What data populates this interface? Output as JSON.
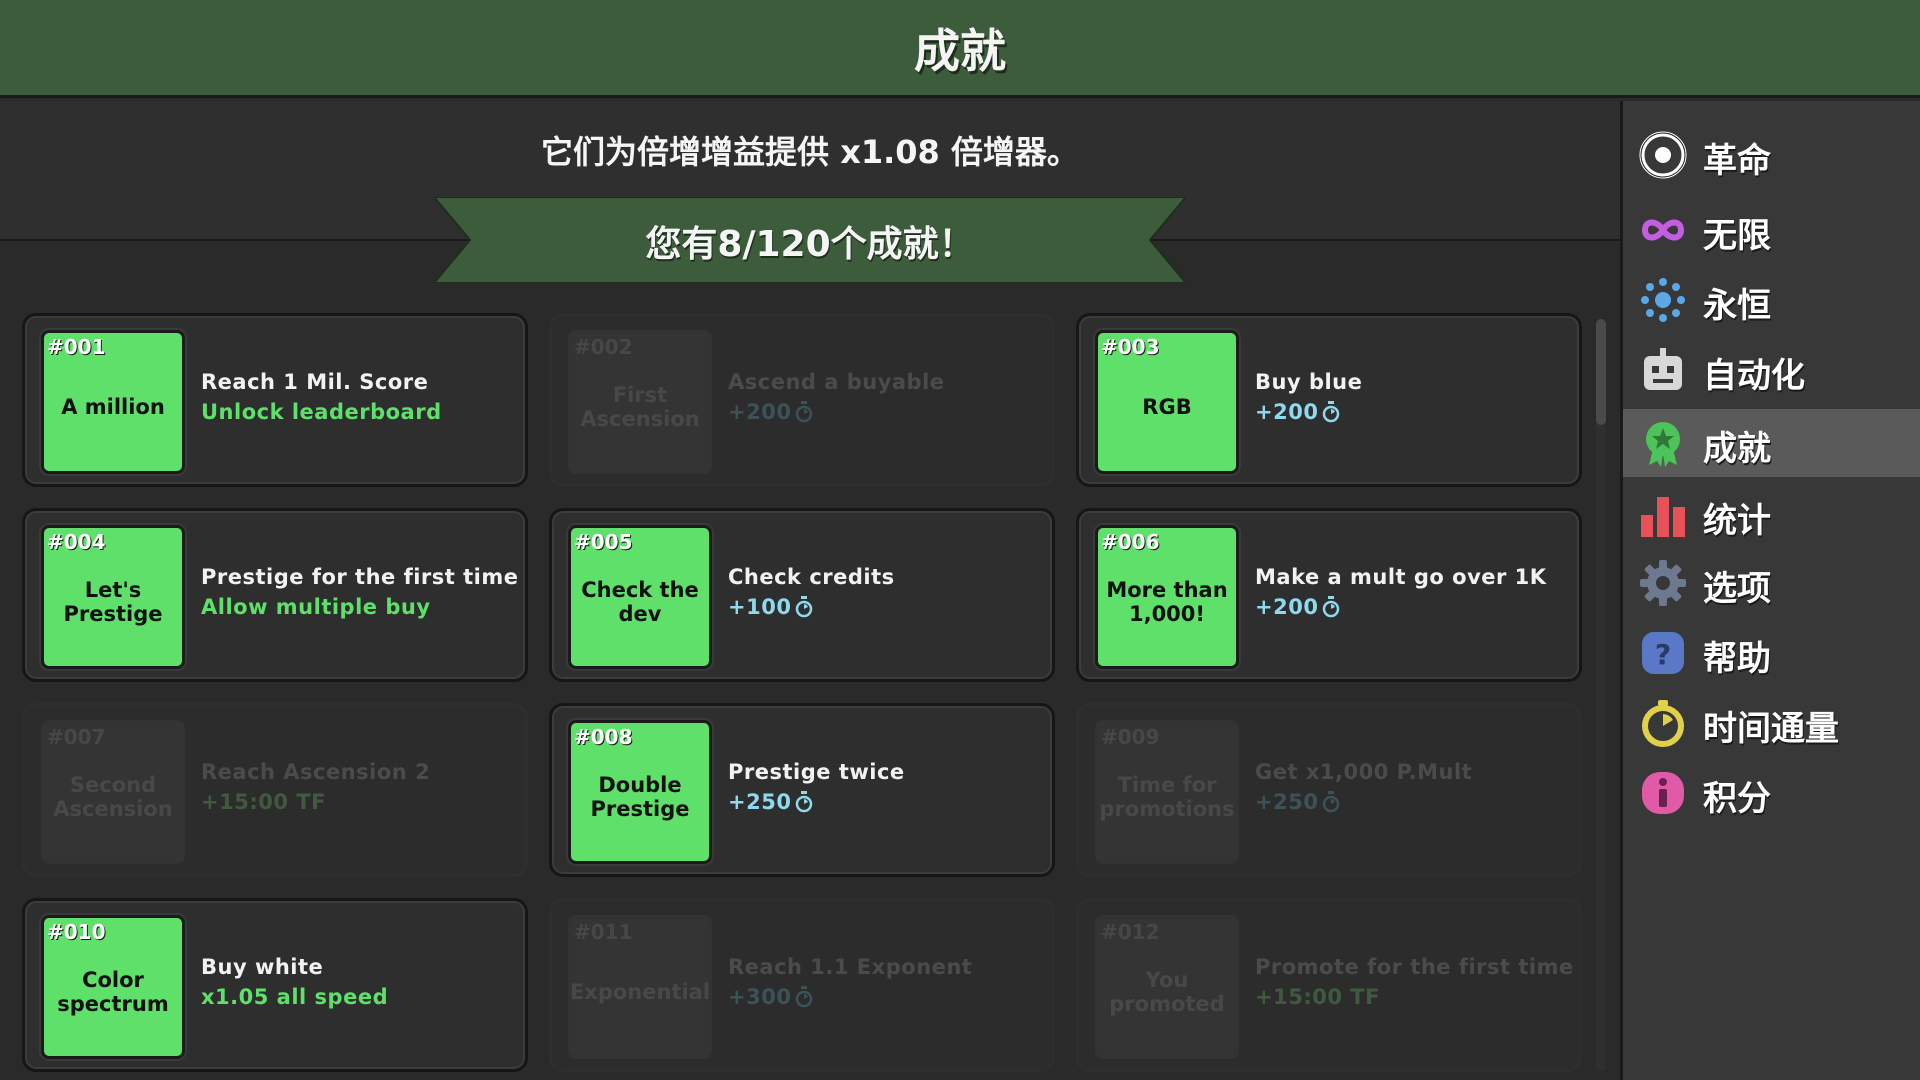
{
  "header": {
    "title": "成就"
  },
  "subtitle": "它们为倍增增益提供 x1.08 倍增器。",
  "banner": {
    "text": "您有8/120个成就！"
  },
  "achievements": [
    {
      "num": "#001",
      "name": "A million",
      "desc": "Reach 1 Mil. Score",
      "reward": "Unlock leaderboard",
      "reward_type": "green",
      "unlocked": true
    },
    {
      "num": "#002",
      "name": "First Ascension",
      "desc": "Ascend a buyable",
      "reward": "+200",
      "reward_type": "blue",
      "unlocked": false
    },
    {
      "num": "#003",
      "name": "RGB",
      "desc": "Buy blue",
      "reward": "+200",
      "reward_type": "blue",
      "unlocked": true
    },
    {
      "num": "#004",
      "name": "Let's Prestige",
      "desc": "Prestige for the first time",
      "reward": "Allow multiple buy",
      "reward_type": "green",
      "unlocked": true
    },
    {
      "num": "#005",
      "name": "Check the dev",
      "desc": "Check credits",
      "reward": "+100",
      "reward_type": "blue",
      "unlocked": true
    },
    {
      "num": "#006",
      "name": "More than 1,000!",
      "desc": "Make a mult go over 1K",
      "reward": "+200",
      "reward_type": "blue",
      "unlocked": true
    },
    {
      "num": "#007",
      "name": "Second Ascension",
      "desc": "Reach Ascension 2",
      "reward": "+15:00 TF",
      "reward_type": "green",
      "unlocked": false
    },
    {
      "num": "#008",
      "name": "Double Prestige",
      "desc": "Prestige twice",
      "reward": "+250",
      "reward_type": "blue",
      "unlocked": true
    },
    {
      "num": "#009",
      "name": "Time for promotions",
      "desc": "Get x1,000 P.Mult",
      "reward": "+250",
      "reward_type": "blue",
      "unlocked": false
    },
    {
      "num": "#010",
      "name": "Color spectrum",
      "desc": "Buy white",
      "reward": "x1.05 all speed",
      "reward_type": "green",
      "unlocked": true
    },
    {
      "num": "#011",
      "name": "Exponential",
      "desc": "Reach 1.1 Exponent",
      "reward": "+300",
      "reward_type": "blue",
      "unlocked": false
    },
    {
      "num": "#012",
      "name": "You promoted",
      "desc": "Promote for the first time",
      "reward": "+15:00 TF",
      "reward_type": "green",
      "unlocked": false
    }
  ],
  "sidebar": {
    "items": [
      {
        "label": "革命",
        "icon": "target-icon",
        "active": false
      },
      {
        "label": "无限",
        "icon": "infinity-icon",
        "active": false
      },
      {
        "label": "永恒",
        "icon": "sun-icon",
        "active": false
      },
      {
        "label": "自动化",
        "icon": "robot-icon",
        "active": false
      },
      {
        "label": "成就",
        "icon": "medal-icon",
        "active": true
      },
      {
        "label": "统计",
        "icon": "bar-chart-icon",
        "active": false
      },
      {
        "label": "选项",
        "icon": "gear-icon",
        "active": false
      },
      {
        "label": "帮助",
        "icon": "help-icon",
        "active": false
      },
      {
        "label": "时间通量",
        "icon": "stopwatch-icon",
        "active": false
      },
      {
        "label": "积分",
        "icon": "info-icon",
        "active": false
      }
    ]
  },
  "colors": {
    "header_bg": "#3d5c3b",
    "tile_unlocked": "#5fe06a",
    "reward_green": "#5ee06a",
    "reward_blue": "#8fd8ee",
    "sidebar_active": "#5a5a5a"
  }
}
